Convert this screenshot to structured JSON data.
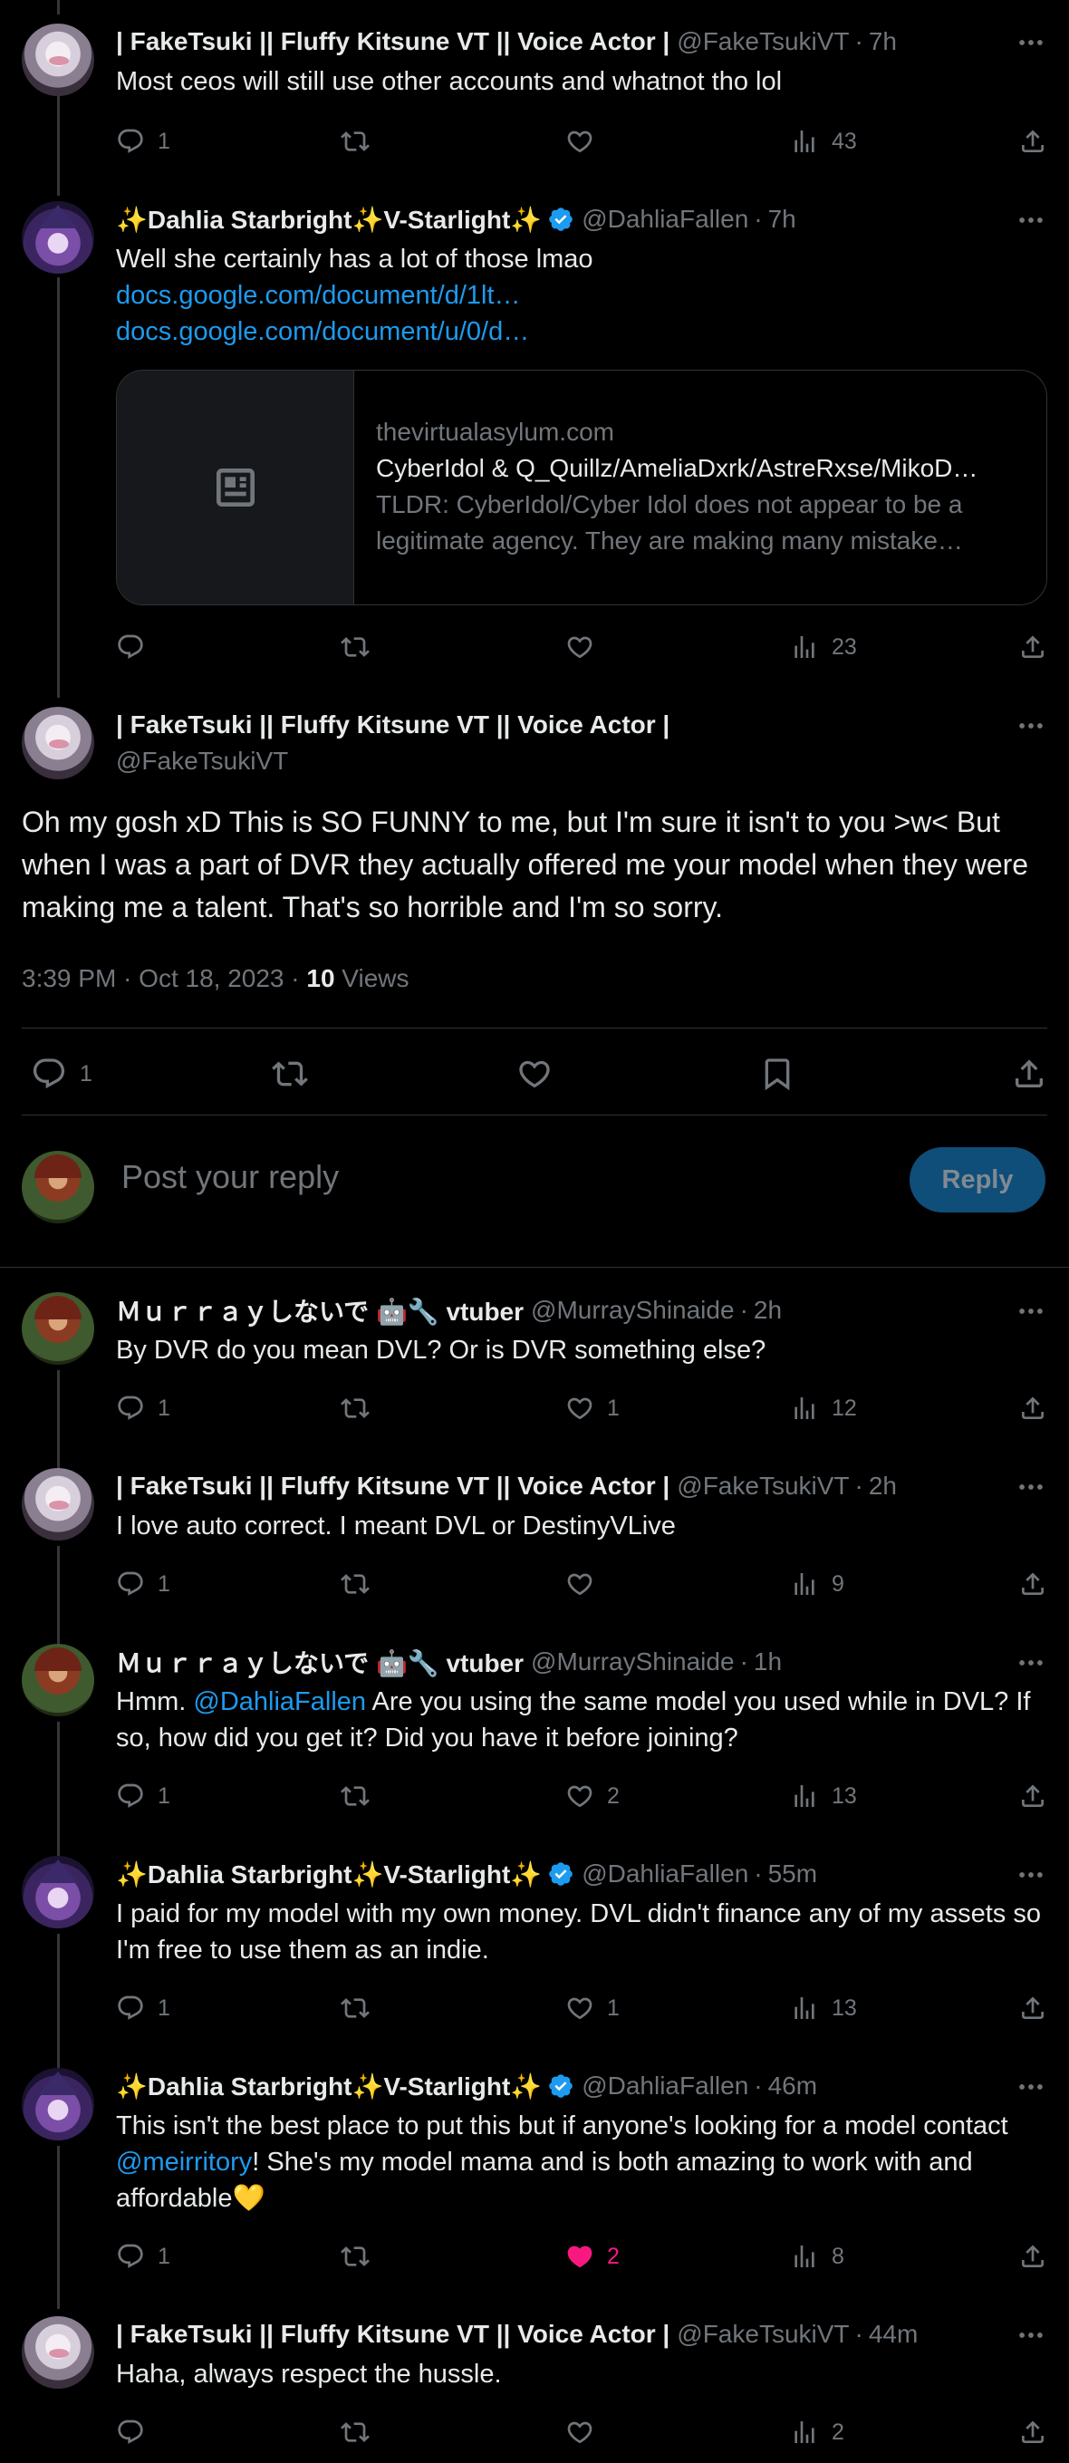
{
  "tweets": [
    {
      "name": "| FakeTsuki || Fluffy Kitsune VT || Voice Actor |",
      "handle": "@FakeTsukiVT",
      "time": "7h",
      "text": "Most ceos will still use other accounts and whatnot tho lol",
      "replies": "1",
      "reposts": "",
      "likes": "",
      "views": "43"
    },
    {
      "name": "✨Dahlia Starbright✨V-Starlight✨",
      "handle": "@DahliaFallen",
      "time": "7h",
      "text": "Well she certainly has a lot of those lmao",
      "link1": "docs.google.com/document/d/1lt…",
      "link2": "docs.google.com/document/u/0/d…",
      "card": {
        "domain": "thevirtualasylum.com",
        "title": "CyberIdol & Q_Quillz/AmeliaDxrk/AstreRxse/MikoD…",
        "desc": "TLDR: CyberIdol/Cyber Idol does not appear to be a legitimate agency. They are making many mistake…"
      },
      "replies": "",
      "reposts": "",
      "likes": "",
      "views": "23"
    },
    {
      "name": "| FakeTsuki || Fluffy Kitsune VT || Voice Actor |",
      "handle": "@FakeTsukiVT",
      "text": "Oh my gosh xD This is SO FUNNY to me, but I'm sure it isn't to you >w< But when I was a part of DVR they actually offered me your model when they were making me a talent. That's so horrible and I'm so sorry.",
      "timestamp": "3:39 PM · Oct 18, 2023 · ",
      "views_count": "10",
      "views_label": " Views",
      "replies": "1"
    },
    {
      "name": "Ｍｕｒｒａｙしないで 🤖🔧 vtuber",
      "handle": "@MurrayShinaide",
      "time": "2h",
      "text": "By DVR do you mean DVL? Or is DVR something else?",
      "replies": "1",
      "reposts": "",
      "likes": "1",
      "views": "12"
    },
    {
      "name": "| FakeTsuki || Fluffy Kitsune VT || Voice Actor |",
      "handle": "@FakeTsukiVT",
      "time": "2h",
      "text": "I love auto correct. I meant DVL or DestinyVLive",
      "replies": "1",
      "reposts": "",
      "likes": "",
      "views": "9"
    },
    {
      "name": "Ｍｕｒｒａｙしないで 🤖🔧 vtuber",
      "handle": "@MurrayShinaide",
      "time": "1h",
      "text_before": "Hmm. ",
      "mention": "@DahliaFallen",
      "text_after": " Are you using the same model you used while in DVL? If so, how did you get it? Did you have it before joining?",
      "replies": "1",
      "reposts": "",
      "likes": "2",
      "views": "13"
    },
    {
      "name": "✨Dahlia Starbright✨V-Starlight✨",
      "handle": "@DahliaFallen",
      "time": "55m",
      "text": "I paid for my model with my own money. DVL didn't finance any of my assets so I'm free to use them as an indie.",
      "replies": "1",
      "reposts": "",
      "likes": "1",
      "views": "13"
    },
    {
      "name": "✨Dahlia Starbright✨V-Starlight✨",
      "handle": "@DahliaFallen",
      "time": "46m",
      "text_before": "This isn't the best place to put this but if anyone's looking for a model contact ",
      "mention": "@meirritory",
      "text_after": "! She's my model mama and is both amazing to work with and affordable💛",
      "replies": "1",
      "reposts": "",
      "likes": "2",
      "views": "8"
    },
    {
      "name": "| FakeTsuki || Fluffy Kitsune VT || Voice Actor |",
      "handle": "@FakeTsukiVT",
      "time": "44m",
      "text": "Haha, always respect the hussle.",
      "replies": "",
      "reposts": "",
      "likes": "",
      "views": "2"
    }
  ],
  "compose": {
    "placeholder": "Post your reply",
    "button": "Reply"
  },
  "sep": "·",
  "colors": {
    "accent": "#1d9bf0",
    "like": "#f91880",
    "muted": "#71767b"
  },
  "icons": [
    "reply-icon",
    "repost-icon",
    "like-icon",
    "views-icon",
    "share-icon",
    "bookmark-icon",
    "more-icon",
    "verified-icon",
    "article-icon"
  ]
}
